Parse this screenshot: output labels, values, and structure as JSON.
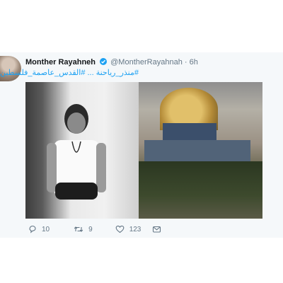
{
  "tweet": {
    "author_name": "Monther Rayahneh",
    "handle": "@MontherRayahnah",
    "separator": "·",
    "time": "6h",
    "text": "#منذر_رياحنة ... #القدس_عاصمة_فلسطين"
  },
  "actions": {
    "replies": "10",
    "retweets": "9",
    "likes": "123"
  },
  "colors": {
    "link": "#1da1f2",
    "meta": "#657786",
    "card_bg": "#f5f8fa"
  }
}
